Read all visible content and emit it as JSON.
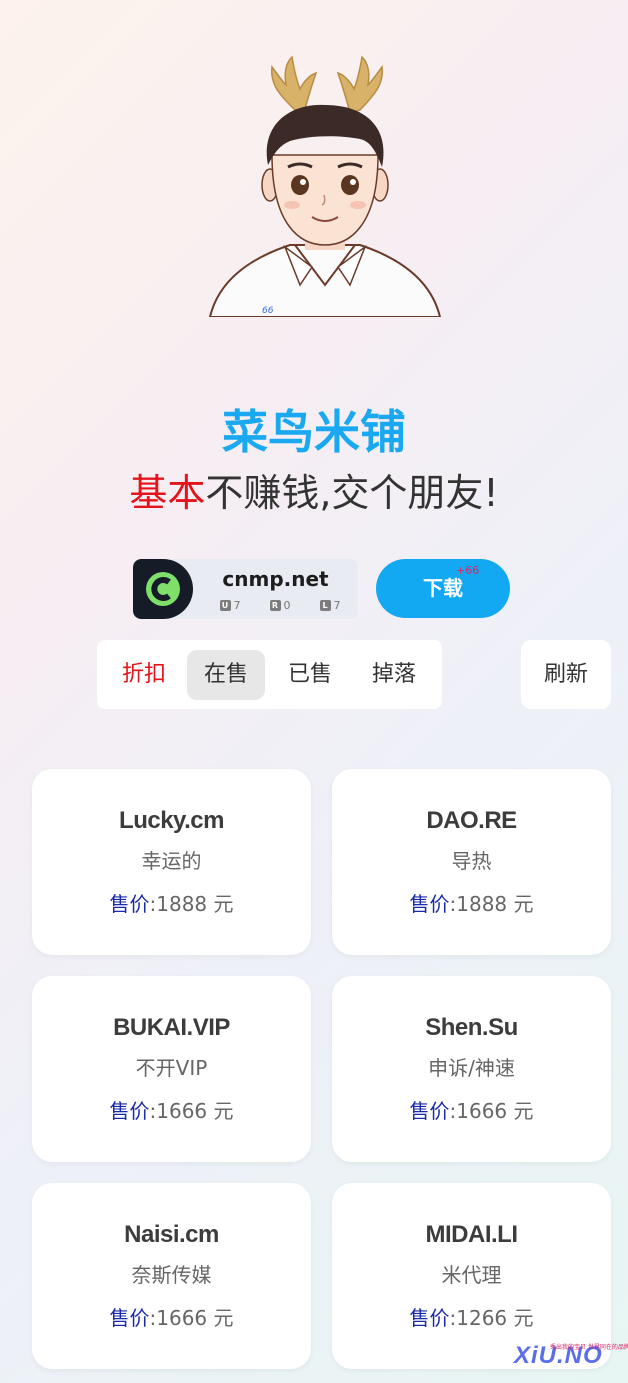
{
  "header": {
    "brand_title": "菜鸟米铺",
    "slogan_highlight": "基本",
    "slogan_rest": "不赚钱,交个朋友!"
  },
  "site_badge": {
    "domain": "cnmp.net",
    "stats": [
      {
        "key": "U",
        "value": "7"
      },
      {
        "key": "R",
        "value": "0"
      },
      {
        "key": "L",
        "value": "7"
      }
    ]
  },
  "download": {
    "label": "下载",
    "badge": "+66"
  },
  "tabs": [
    {
      "label": "折扣",
      "state": "discount"
    },
    {
      "label": "在售",
      "state": "active"
    },
    {
      "label": "已售",
      "state": ""
    },
    {
      "label": "掉落",
      "state": ""
    }
  ],
  "refresh_label": "刷新",
  "listings": [
    {
      "domain": "Lucky.cm",
      "meaning": "幸运的",
      "price_label": "售价",
      "price_value": ":1888 元"
    },
    {
      "domain": "DAO.RE",
      "meaning": "导热",
      "price_label": "售价",
      "price_value": ":1888 元"
    },
    {
      "domain": "BUKAI.VIP",
      "meaning": "不开VIP",
      "price_label": "售价",
      "price_value": ":1666 元"
    },
    {
      "domain": "Shen.Su",
      "meaning": "申诉/神速",
      "price_label": "售价",
      "price_value": ":1666 元"
    },
    {
      "domain": "Naisi.cm",
      "meaning": "奈斯传媒",
      "price_label": "售价",
      "price_value": ":1666 元"
    },
    {
      "domain": "MIDAI.LI",
      "meaning": "米代理",
      "price_label": "售价",
      "price_value": ":1266 元"
    }
  ],
  "watermark": {
    "text": "XiU.NO",
    "tagline": "秀出我的宝贝 世界同在的品牌"
  },
  "colors": {
    "brand": "#1aa9f0",
    "highlight": "#e3141b",
    "price_label": "#1a2aa8",
    "download_bg": "#13a8f2"
  }
}
